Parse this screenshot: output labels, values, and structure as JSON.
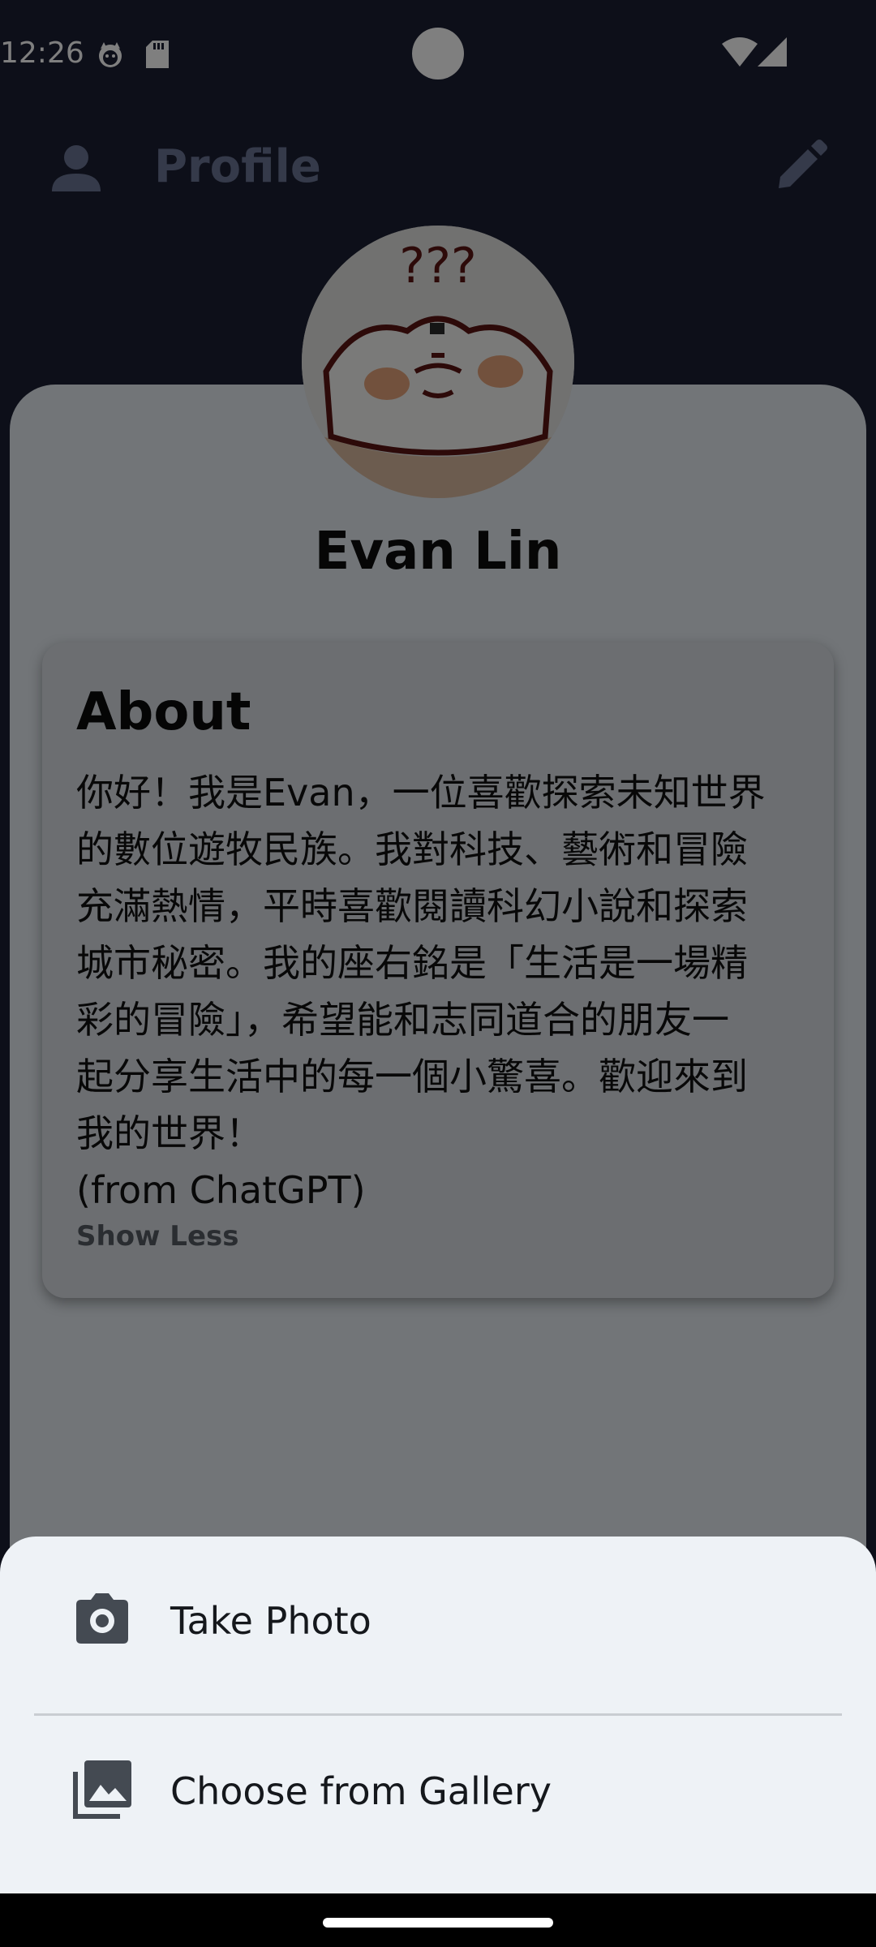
{
  "status_bar": {
    "time": "12:26",
    "icons": [
      "cat-notification-icon",
      "sd-card-icon",
      "wifi-icon",
      "signal-icon"
    ]
  },
  "app_bar": {
    "title": "Profile",
    "leading_icon": "person-icon",
    "action_icon": "edit-icon"
  },
  "profile": {
    "name": "Evan Lin",
    "avatar_text": "???"
  },
  "about": {
    "heading": "About",
    "text": "你好！我是Evan，一位喜歡探索未知世界\n的數位遊牧民族。我對科技、藝術和冒險\n充滿熱情，平時喜歡閱讀科幻小說和探索\n城市秘密。我的座右銘是「生活是一場精\n彩的冒險」，希望能和志同道合的朋友一\n起分享生活中的每一個小驚喜。歡迎來到\n我的世界！\n(from ChatGPT)",
    "toggle_label": "Show Less"
  },
  "bottom_sheet": {
    "options": [
      {
        "label": "Take Photo",
        "icon": "camera-icon"
      },
      {
        "label": "Choose from Gallery",
        "icon": "gallery-icon"
      }
    ]
  },
  "colors": {
    "background": "#1b1f33",
    "card": "#e4eaf0",
    "sheet": "#eef2f6",
    "title": "#6b7594"
  }
}
